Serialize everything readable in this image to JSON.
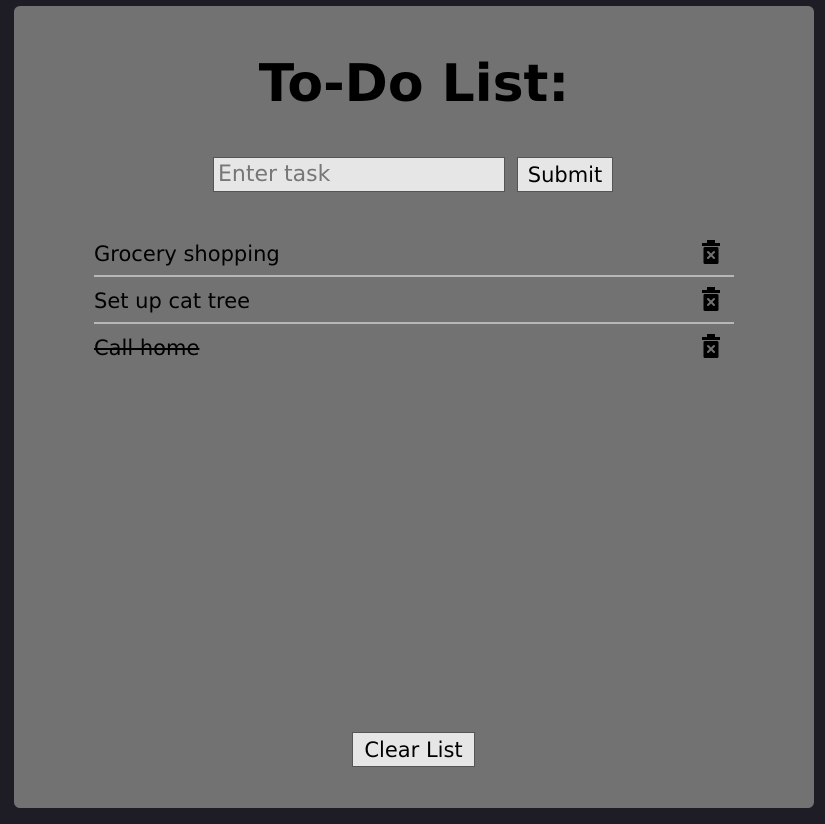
{
  "header": {
    "title": "To-Do List:"
  },
  "form": {
    "input_value": "",
    "input_placeholder": "Enter task",
    "submit_label": "Submit"
  },
  "tasks": [
    {
      "text": "Grocery shopping",
      "completed": false,
      "icon": "trash-icon"
    },
    {
      "text": "Set up cat tree",
      "completed": false,
      "icon": "trash-icon"
    },
    {
      "text": "Call home",
      "completed": true,
      "icon": "trash-icon"
    }
  ],
  "footer": {
    "clear_label": "Clear List"
  },
  "colors": {
    "page_background": "#1e1c25",
    "panel_background": "#727272",
    "divider": "#b7b7b7",
    "control_background": "#e6e6e6"
  }
}
